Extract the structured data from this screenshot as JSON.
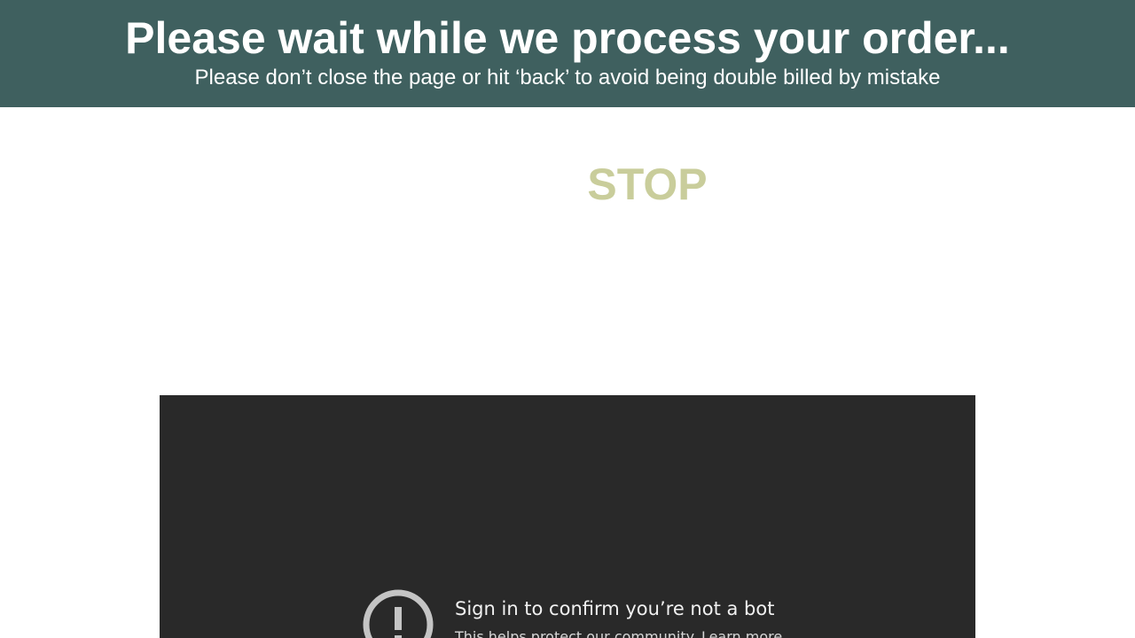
{
  "banner": {
    "title": "Please wait while we process your order...",
    "subtitle": "Please don’t close the page or hit ‘back’ to avoid being double billed by mistake",
    "background_color": "#3f605f"
  },
  "main": {
    "stop_label": "STOP",
    "stop_color": "#c9cd9b"
  },
  "video": {
    "icon": "warning-circle-icon",
    "signin_title": "Sign in to confirm you’re not a bot",
    "signin_subtitle": "This helps protect our community.",
    "learn_more_label": "Learn more",
    "background_color": "#292929"
  }
}
